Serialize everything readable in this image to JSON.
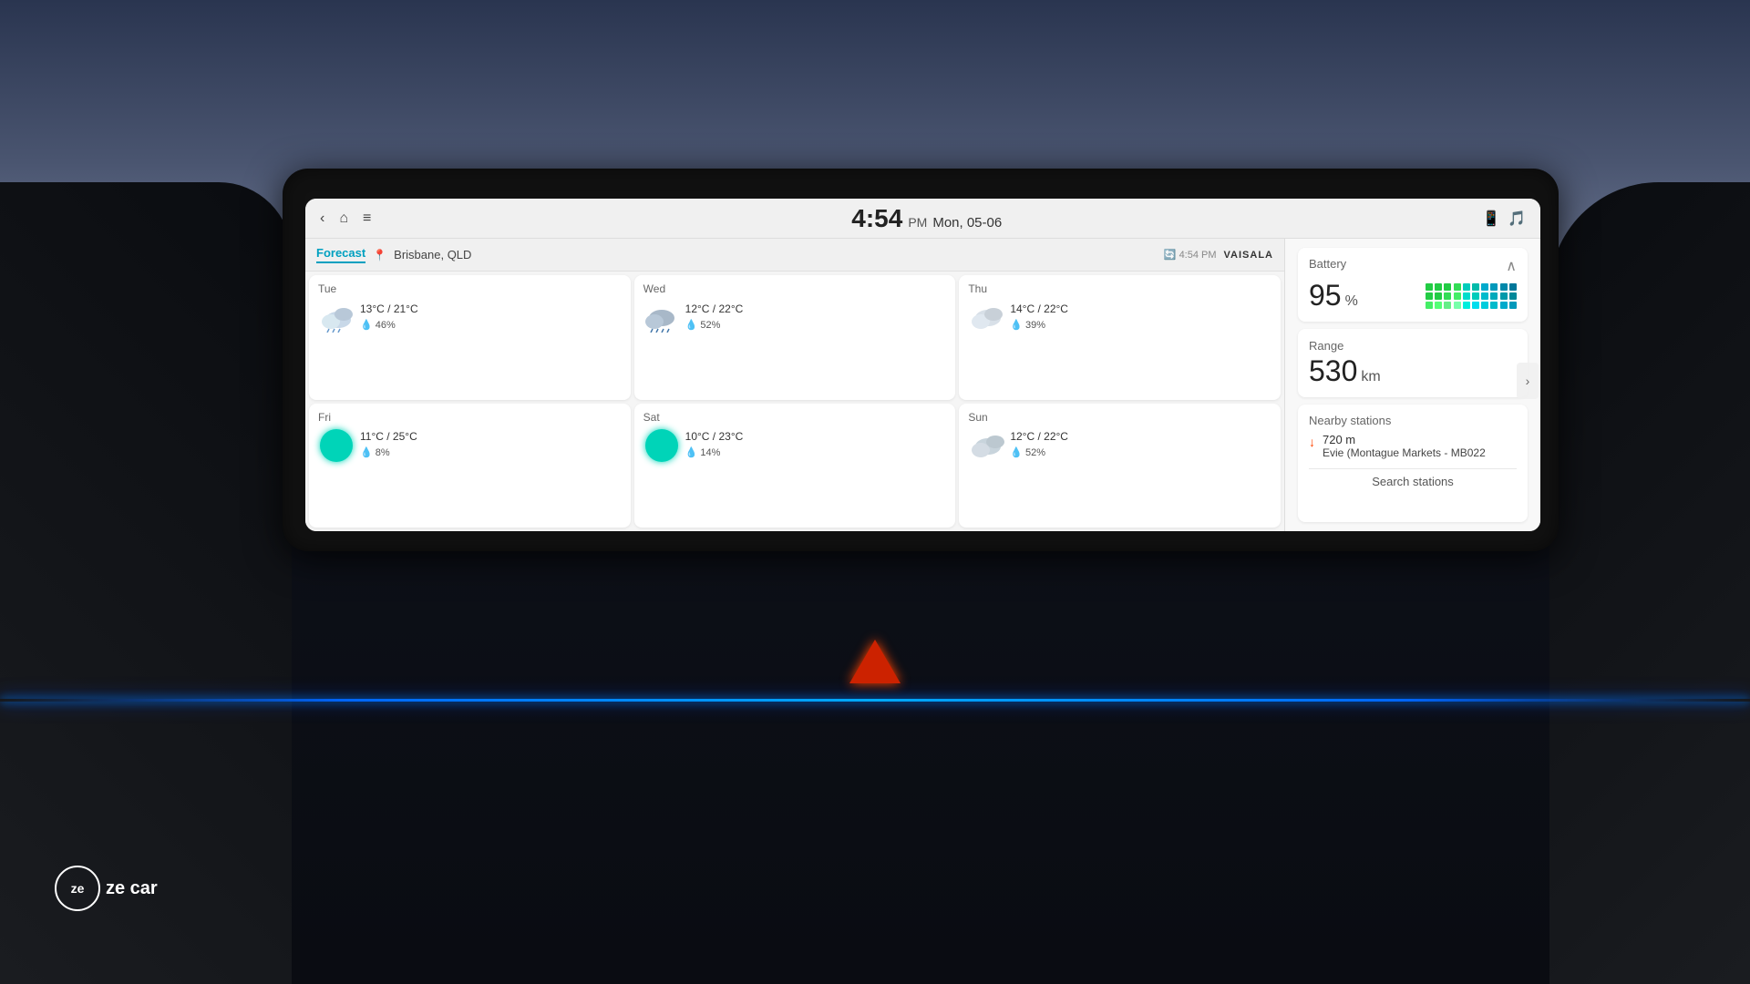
{
  "background": {
    "sky_gradient": "dusk sky with clouds"
  },
  "status_bar": {
    "time": "4:54",
    "ampm": "PM",
    "date": "Mon, 05-06",
    "back_label": "‹",
    "home_label": "⌂",
    "menu_label": "≡"
  },
  "weather": {
    "tab_label": "Forecast",
    "location_icon": "📍",
    "location": "Brisbane, QLD",
    "update_time": "4:54 PM",
    "provider": "VAISALA",
    "days": [
      {
        "day": "Tue",
        "temp_low": "13°C",
        "temp_high": "21°C",
        "rain_chance": "46%",
        "icon_type": "cloud-rain"
      },
      {
        "day": "Wed",
        "temp_low": "12°C",
        "temp_high": "22°C",
        "rain_chance": "52%",
        "icon_type": "cloud-rain"
      },
      {
        "day": "Thu",
        "temp_low": "14°C",
        "temp_high": "22°C",
        "rain_chance": "39%",
        "icon_type": "cloud"
      },
      {
        "day": "Fri",
        "temp_low": "11°C",
        "temp_high": "25°C",
        "rain_chance": "8%",
        "icon_type": "sun"
      },
      {
        "day": "Sat",
        "temp_low": "10°C",
        "temp_high": "23°C",
        "rain_chance": "14%",
        "icon_type": "sun"
      },
      {
        "day": "Sun",
        "temp_low": "12°C",
        "temp_high": "22°C",
        "rain_chance": "52%",
        "icon_type": "cloud"
      }
    ]
  },
  "ev": {
    "battery_label": "Battery",
    "battery_value": "95",
    "battery_unit": "%",
    "range_label": "Range",
    "range_value": "530",
    "range_unit": "km",
    "nearby_label": "Nearby stations",
    "station_distance": "720 m",
    "station_name": "Evie (Montague Markets - MB022",
    "search_label": "Search stations"
  },
  "zecar": {
    "logo_text": "ze car"
  },
  "colors": {
    "teal": "#00c8b8",
    "accent_blue": "#0080ff",
    "battery_green": "#22cc44"
  }
}
